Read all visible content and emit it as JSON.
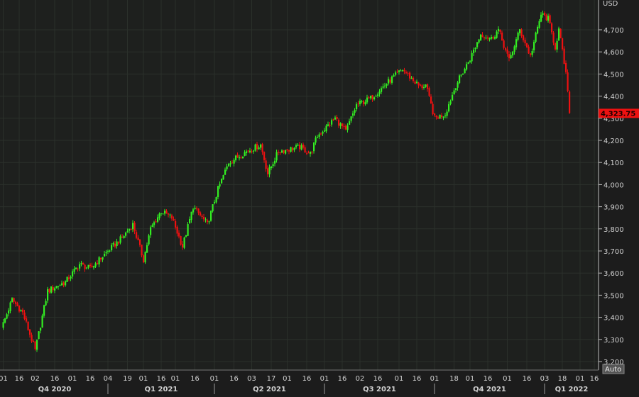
{
  "chart_data": {
    "type": "candlestick",
    "currency_label": "USD",
    "last_price_label": "4,323.75",
    "last_price": 4323.75,
    "auto_button": "Auto",
    "ylim": [
      3150,
      4800
    ],
    "y_ticks": [
      3200,
      3300,
      3400,
      3500,
      3600,
      3700,
      3800,
      3900,
      4000,
      4100,
      4200,
      4300,
      4400,
      4500,
      4600,
      4700
    ],
    "y_tick_labels": [
      "3,200",
      "3,300",
      "3,400",
      "3,500",
      "3,600",
      "3,700",
      "3,800",
      "3,900",
      "4,000",
      "4,100",
      "4,200",
      "4,300",
      "4,400",
      "4,500",
      "4,600",
      "4,700"
    ],
    "x_ticks": [
      {
        "s": 1,
        "l": "01"
      },
      {
        "s": 10,
        "l": "16"
      },
      {
        "s": 19,
        "l": "02"
      },
      {
        "s": 30,
        "l": "16"
      },
      {
        "s": 40,
        "l": "01"
      },
      {
        "s": 50,
        "l": "16"
      },
      {
        "s": 60,
        "l": "04"
      },
      {
        "s": 71,
        "l": "19"
      },
      {
        "s": 80,
        "l": "01"
      },
      {
        "s": 90,
        "l": "16"
      },
      {
        "s": 98,
        "l": "01"
      },
      {
        "s": 109,
        "l": "16"
      },
      {
        "s": 120,
        "l": "01"
      },
      {
        "s": 131,
        "l": "16"
      },
      {
        "s": 141,
        "l": "03"
      },
      {
        "s": 152,
        "l": "17"
      },
      {
        "s": 161,
        "l": "01"
      },
      {
        "s": 172,
        "l": "16"
      },
      {
        "s": 182,
        "l": "01"
      },
      {
        "s": 192,
        "l": "16"
      },
      {
        "s": 202,
        "l": "02"
      },
      {
        "s": 212,
        "l": "16"
      },
      {
        "s": 224,
        "l": "01"
      },
      {
        "s": 234,
        "l": "16"
      },
      {
        "s": 244,
        "l": "01"
      },
      {
        "s": 255,
        "l": "18"
      },
      {
        "s": 264,
        "l": "01"
      },
      {
        "s": 274,
        "l": "16"
      },
      {
        "s": 285,
        "l": "01"
      },
      {
        "s": 296,
        "l": "16"
      },
      {
        "s": 306,
        "l": "03"
      },
      {
        "s": 316,
        "l": "18"
      },
      {
        "s": 326,
        "l": "01"
      },
      {
        "s": 334,
        "l": "16"
      }
    ],
    "quarters": [
      {
        "s": 0,
        "end": 60,
        "l": "Q4 2020"
      },
      {
        "s": 60,
        "end": 120,
        "l": "Q1 2021"
      },
      {
        "s": 120,
        "end": 182,
        "l": "Q2 2021"
      },
      {
        "s": 182,
        "end": 244,
        "l": "Q3 2021"
      },
      {
        "s": 244,
        "end": 306,
        "l": "Q4 2021"
      },
      {
        "s": 306,
        "end": 340,
        "l": "Q1 2022"
      }
    ],
    "price_path": [
      [
        0,
        3350
      ],
      [
        6,
        3480
      ],
      [
        12,
        3420
      ],
      [
        19,
        3250
      ],
      [
        26,
        3520
      ],
      [
        36,
        3560
      ],
      [
        44,
        3640
      ],
      [
        50,
        3620
      ],
      [
        60,
        3700
      ],
      [
        68,
        3760
      ],
      [
        74,
        3820
      ],
      [
        80,
        3660
      ],
      [
        84,
        3800
      ],
      [
        90,
        3880
      ],
      [
        96,
        3850
      ],
      [
        102,
        3720
      ],
      [
        108,
        3900
      ],
      [
        116,
        3820
      ],
      [
        122,
        3980
      ],
      [
        128,
        4100
      ],
      [
        138,
        4150
      ],
      [
        146,
        4180
      ],
      [
        150,
        4050
      ],
      [
        156,
        4150
      ],
      [
        168,
        4170
      ],
      [
        174,
        4140
      ],
      [
        178,
        4220
      ],
      [
        188,
        4300
      ],
      [
        194,
        4240
      ],
      [
        200,
        4360
      ],
      [
        208,
        4390
      ],
      [
        212,
        4420
      ],
      [
        220,
        4480
      ],
      [
        226,
        4520
      ],
      [
        236,
        4440
      ],
      [
        239,
        4450
      ],
      [
        244,
        4300
      ],
      [
        250,
        4320
      ],
      [
        256,
        4450
      ],
      [
        264,
        4570
      ],
      [
        270,
        4680
      ],
      [
        276,
        4660
      ],
      [
        280,
        4700
      ],
      [
        286,
        4560
      ],
      [
        292,
        4700
      ],
      [
        298,
        4580
      ],
      [
        304,
        4770
      ],
      [
        308,
        4750
      ],
      [
        312,
        4620
      ],
      [
        314,
        4700
      ],
      [
        318,
        4500
      ],
      [
        320,
        4323.75
      ]
    ],
    "colors": {
      "up": "#33ee22",
      "down": "#ee1111",
      "grid": "#2b302b",
      "axis": "#d0d0d0",
      "bg": "#1c1c1c"
    }
  }
}
